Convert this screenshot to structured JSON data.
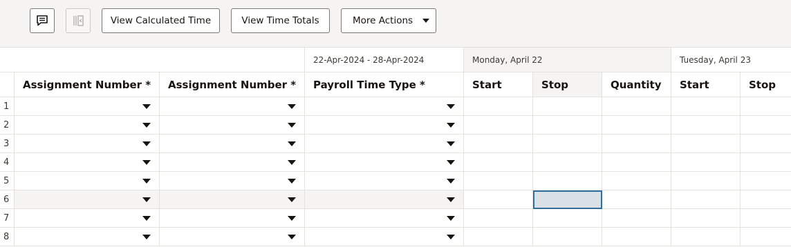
{
  "toolbar": {
    "icon1": "comment-icon",
    "icon2": "panel-toggle-icon",
    "view_calculated_time": "View Calculated Time",
    "view_time_totals": "View Time Totals",
    "more_actions": "More Actions"
  },
  "header": {
    "period": "22-Apr-2024 - 28-Apr-2024",
    "day1": "Monday, April 22",
    "day2": "Tuesday, April 23",
    "columns": {
      "assignment1": "Assignment Number *",
      "assignment2": "Assignment Number *",
      "payroll": "Payroll Time Type *",
      "start1": "Start",
      "stop1": "Stop",
      "quantity1": "Quantity",
      "start2": "Start",
      "stop2": "Stop"
    }
  },
  "rows": [
    "1",
    "2",
    "3",
    "4",
    "5",
    "6",
    "7",
    "8"
  ],
  "selected_row": "6",
  "colors": {
    "selected_border": "#2e6f9e",
    "selected_fill": "#d9e1e7",
    "toolbar_bg": "#f5f4f2"
  }
}
